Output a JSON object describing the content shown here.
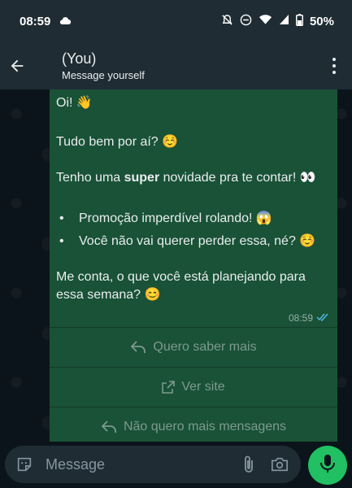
{
  "status_bar": {
    "time": "08:59",
    "battery": "50%"
  },
  "header": {
    "title": "(You)",
    "subtitle": "Message yourself"
  },
  "message": {
    "greeting": "Oi! 👋",
    "line2": "Tudo bem por aí? ☺️",
    "line3_before": "Tenho uma ",
    "line3_bold": "super",
    "line3_after": " novidade pra te contar! 👀",
    "bullets": [
      "Promoção imperdível rolando! 😱",
      "Você não vai querer perder essa, né? ☺️"
    ],
    "closing": "Me conta, o que você está planejando para essa semana? 😊",
    "time": "08:59"
  },
  "quick_replies": [
    {
      "label": "Quero saber mais",
      "icon": "reply-icon"
    },
    {
      "label": "Ver site",
      "icon": "external-link-icon"
    },
    {
      "label": "Não quero mais mensagens",
      "icon": "reply-icon"
    }
  ],
  "composer": {
    "placeholder": "Message"
  },
  "colors": {
    "bubble": "#195236",
    "accent": "#21c063",
    "header": "#1f2c34"
  }
}
